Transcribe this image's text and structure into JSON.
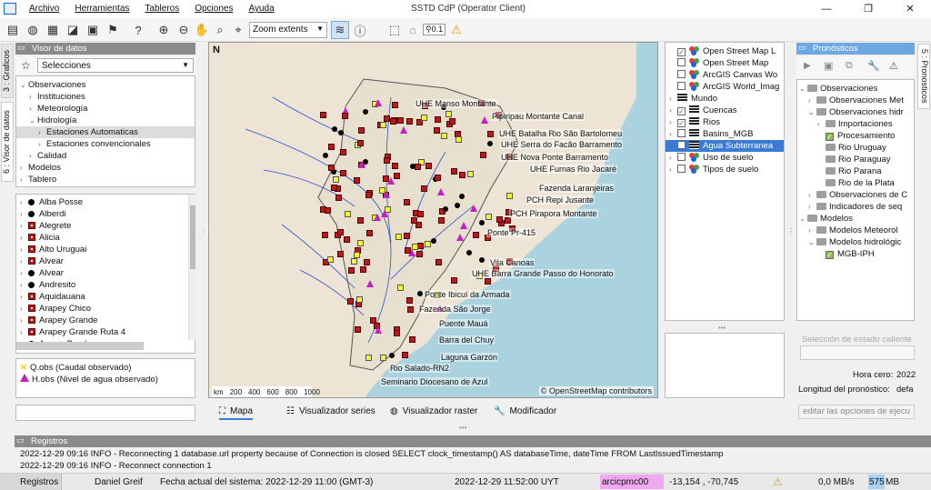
{
  "window": {
    "title": "SSTD CdP  (Operator Client)",
    "menu": [
      "Archivo",
      "Herramientas",
      "Tableros",
      "Opciones",
      "Ayuda"
    ],
    "controls": [
      "—",
      "❐",
      "✕"
    ]
  },
  "toolbar": {
    "zoom_value": "Zoom extents",
    "badge": "0.1"
  },
  "side_tabs": {
    "left_top": "3 : Graficos",
    "left_bottom": "6 : Visor de datos",
    "right": "5 : Pronosticos"
  },
  "visor": {
    "header": "Visor de datos",
    "selector": "Selecciones",
    "tree": [
      {
        "label": "Observaciones",
        "level": 0,
        "open": true
      },
      {
        "label": "Instituciones",
        "level": 1,
        "open": false
      },
      {
        "label": "Meteorología",
        "level": 1,
        "open": false
      },
      {
        "label": "Hidrología",
        "level": 1,
        "open": true
      },
      {
        "label": "Estaciones Automaticas",
        "level": 2,
        "open": false,
        "selected": true
      },
      {
        "label": "Estaciones convencionales",
        "level": 2,
        "open": false
      },
      {
        "label": "Calidad",
        "level": 1,
        "open": false
      },
      {
        "label": "Modelos",
        "level": 0,
        "open": false
      },
      {
        "label": "Tablero",
        "level": 0,
        "open": false
      }
    ],
    "stations": [
      {
        "name": "Alba Posse",
        "type": "dot"
      },
      {
        "name": "Alberdi",
        "type": "dot"
      },
      {
        "name": "Alegrete",
        "type": "square"
      },
      {
        "name": "Alicia",
        "type": "square"
      },
      {
        "name": "Alto Uruguai",
        "type": "square"
      },
      {
        "name": "Alvear",
        "type": "square"
      },
      {
        "name": "Alvear",
        "type": "dot"
      },
      {
        "name": "Andresito",
        "type": "dot"
      },
      {
        "name": "Aquidauana",
        "type": "square"
      },
      {
        "name": "Arapey Chico",
        "type": "square"
      },
      {
        "name": "Arapey Grande",
        "type": "square"
      },
      {
        "name": "Arapey Grande Ruta 4",
        "type": "square"
      },
      {
        "name": "Arroyo Borches",
        "type": "dot"
      }
    ],
    "legend": [
      {
        "label": "Q.obs (Caudal observado)",
        "symbol": "cross",
        "color": "#f4d40b"
      },
      {
        "label": "H.obs (Nivel de agua observado)",
        "symbol": "triangle",
        "color": "#c51ec5"
      }
    ]
  },
  "map": {
    "north": "N",
    "attribution": "© OpenStreetMap contributors",
    "scale": [
      "km",
      "200",
      "400",
      "600",
      "800",
      "1000"
    ],
    "labels": [
      "UHE Manso Montante",
      "Pipiripau Montante Canal",
      "UHE Batalha Rio São Bartolomeu",
      "UHE Serra do Facão Barramento",
      "UHE Nova Ponte Barramento",
      "UHE Furnas Rio Jacaré",
      "Fazenda Laranjeiras",
      "PCH Repi Jusante",
      "PCH Pirapora Montante",
      "Ponte Pr-415",
      "Vila Canoas",
      "UHE Barra Grande Passo do Honorato",
      "Ponte Ibicuí da Armada",
      "Fazenda São Jorge",
      "Puente Mauá",
      "Barra del Chuy",
      "Laguna Garzón",
      "Rio Salado-RN2",
      "Seminario Diocesano de Azul"
    ]
  },
  "map_tabs": [
    {
      "label": "Mapa",
      "icon": "map-icon"
    },
    {
      "label": "Visualizador series",
      "icon": "series-icon"
    },
    {
      "label": "Visualizador raster",
      "icon": "globe-icon"
    },
    {
      "label": "Modificador",
      "icon": "wrench-icon"
    }
  ],
  "layers": [
    {
      "label": "Open Street Map L",
      "checked": true,
      "icon": "bullet3"
    },
    {
      "label": "Open Street Map",
      "checked": false,
      "icon": "bullet3"
    },
    {
      "label": "ArcGIS Canvas Wo",
      "checked": false,
      "icon": "bullet3"
    },
    {
      "label": "ArcGIS World_Imag",
      "checked": false,
      "icon": "bullet3"
    },
    {
      "label": "Mundo",
      "checked": null,
      "icon": "stack",
      "expandable": true
    },
    {
      "label": "Cuencas",
      "checked": true,
      "icon": "stack",
      "expandable": true
    },
    {
      "label": "Rios",
      "checked": true,
      "icon": "stack",
      "expandable": true
    },
    {
      "label": "Basins_MGB",
      "checked": false,
      "icon": "stack",
      "expandable": true
    },
    {
      "label": "Agua Subterranea",
      "checked": false,
      "icon": "stack",
      "expandable": true,
      "selected": true
    },
    {
      "label": "Uso de suelo",
      "checked": false,
      "icon": "bullet3",
      "expandable": true
    },
    {
      "label": "Tipos de suelo",
      "checked": false,
      "icon": "bullet3",
      "expandable": true
    }
  ],
  "forecast": {
    "header": "Pronósticos",
    "tree": [
      {
        "label": "Observaciones",
        "level": 0,
        "open": true,
        "icon": "folder"
      },
      {
        "label": "Observaciones Met",
        "level": 1,
        "open": false,
        "icon": "folder"
      },
      {
        "label": "Observaciones hidr",
        "level": 1,
        "open": true,
        "icon": "folder"
      },
      {
        "label": "Importaciones",
        "level": 2,
        "open": false,
        "icon": "folder"
      },
      {
        "label": "Procesamiento",
        "level": 2,
        "open": null,
        "icon": "check"
      },
      {
        "label": "Rio Uruguay",
        "level": 2,
        "open": null,
        "icon": "folder"
      },
      {
        "label": "Rio Paraguay",
        "level": 2,
        "open": null,
        "icon": "folder"
      },
      {
        "label": "Rio Parana",
        "level": 2,
        "open": null,
        "icon": "folder"
      },
      {
        "label": "Rio de la Plata",
        "level": 2,
        "open": null,
        "icon": "folder"
      },
      {
        "label": "Observaciones de C",
        "level": 1,
        "open": false,
        "icon": "folder"
      },
      {
        "label": "Indicadores de seq",
        "level": 1,
        "open": false,
        "icon": "folder"
      },
      {
        "label": "Modelos",
        "level": 0,
        "open": true,
        "icon": "folder"
      },
      {
        "label": "Modelos Meteorol",
        "level": 1,
        "open": false,
        "icon": "folder"
      },
      {
        "label": "Modelos hidrológic",
        "level": 1,
        "open": true,
        "icon": "folder"
      },
      {
        "label": "MGB-IPH",
        "level": 2,
        "open": null,
        "icon": "check"
      }
    ],
    "state_label": "Selección de estado caliente",
    "hora_cero_label": "Hora cero:",
    "hora_cero_value": "2022",
    "longitud_label": "Longitud del pronóstico:",
    "longitud_value": "defa",
    "edit_button": "editar las opciones de ejecu"
  },
  "registros": {
    "header": "Registros",
    "lines": [
      "2022-12-29 09:16 INFO - Reconnecting 1  database.url property because of Connection is closed SELECT clock_timestamp() AS databaseTime, dateTime FROM LastIssuedTimestamp",
      "2022-12-29 09:16 INFO - Reconnect connection 1"
    ]
  },
  "status": {
    "tab": "Registros",
    "user": "Daniel Greif",
    "system_date": "Fecha actual del sistema: 2022-12-29 11:00 (GMT-3)",
    "uyt": "2022-12-29 11:52:00 UYT",
    "host": "arcicpmc00",
    "coords": "-13,154 , -70,745",
    "rate": "0,0 MB/s",
    "mem_used": "575",
    "mem_unit": "MB"
  }
}
